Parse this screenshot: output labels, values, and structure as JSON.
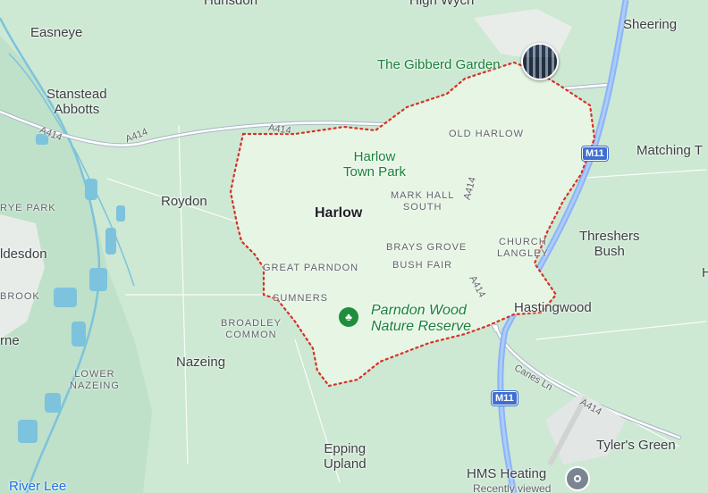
{
  "colors": {
    "land": "#cde8d3",
    "urban": "#eef2ef",
    "boundary_fill": "#e6f5e4",
    "boundary_line": "#d93025",
    "motorway": "#8ab4f8",
    "a_road": "#ffffff",
    "water": "#7dc3dd",
    "poi_green": "#188038"
  },
  "places": {
    "hunsdon": "Hunsdon",
    "high_wych": "High Wych",
    "sheering": "Sheering",
    "easneye": "Easneye",
    "stanstead_abbotts": "Stanstead\nAbbotts",
    "roydon": "Roydon",
    "rye_park": "RYE PARK",
    "hoddesdon": "ldesdon",
    "brook": "BROOK",
    "broxbourne": "rne",
    "broadley_common": "BROADLEY\nCOMMON",
    "nazeing": "Nazeing",
    "lower_nazeing": "LOWER\nNAZEING",
    "epping_upland": "Epping\nUpland",
    "harlow": "Harlow",
    "old_harlow": "OLD HARLOW",
    "mark_hall_south": "MARK HALL\nSOUTH",
    "brays_grove": "BRAYS GROVE",
    "bush_fair": "BUSH FAIR",
    "church_langley": "CHURCH\nLANGLEY",
    "great_parndon": "GREAT PARNDON",
    "sumners": "SUMNERS",
    "matching_tye": "Matching T",
    "threshers_bush": "Threshers\nBush",
    "hastingwood": "Hastingwood",
    "tylers_green": "Tyler's Green",
    "edge_h": "H"
  },
  "pois": {
    "gibberd_garden": "The Gibberd Garden",
    "harlow_town_park": "Harlow\nTown Park",
    "parndon_wood": "Parndon Wood\nNature Reserve",
    "river_lee": "River Lee",
    "hms_heating": "HMS Heating",
    "recently_viewed": "Recently viewed"
  },
  "roads": {
    "a414_a": "A414",
    "a414_b": "A414",
    "a414_c": "A414",
    "a414_d": "A414",
    "a414_e": "A414",
    "a414_f": "A414",
    "m11_a": "M11",
    "m11_b": "M11",
    "canes_ln": "Canes Ln"
  },
  "icons": {
    "gibberd_pin": "photo-pin-icon",
    "parndon_tree": "tree-icon",
    "hms_place": "place-icon"
  }
}
